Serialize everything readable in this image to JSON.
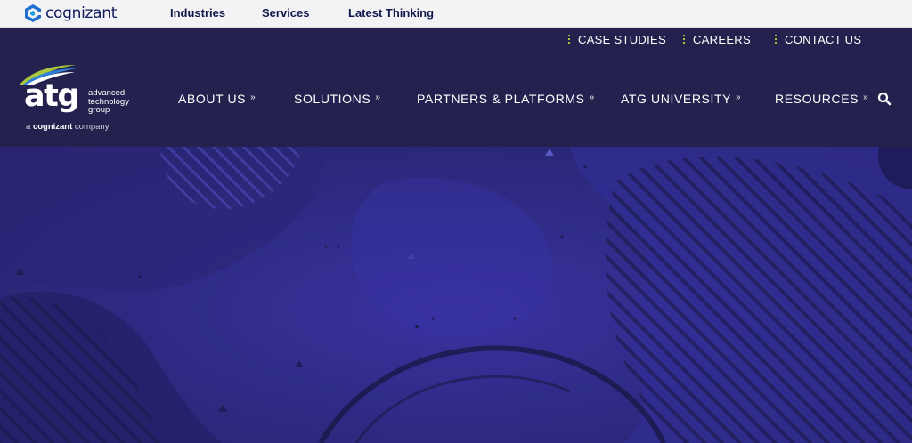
{
  "cognizant_bar": {
    "logo_text": "cognizant",
    "logo_icon": "cognizant-hex-icon",
    "links": [
      "Industries",
      "Services",
      "Latest Thinking"
    ]
  },
  "utility_nav": {
    "items": [
      "CASE STUDIES",
      "CAREERS",
      "CONTACT US"
    ],
    "bullet_color": "#a9c73a"
  },
  "atg_logo": {
    "wordmark": "atg",
    "desc_lines": [
      "advanced",
      "technology",
      "group"
    ],
    "tagline_prefix": "a",
    "tagline_brand": "cognizant",
    "tagline_suffix": "company"
  },
  "main_nav": {
    "items": [
      {
        "label": "ABOUT US",
        "icon": "double-chevron-down-icon"
      },
      {
        "label": "SOLUTIONS",
        "icon": "double-chevron-down-icon"
      },
      {
        "label": "PARTNERS & PLATFORMS",
        "icon": "double-chevron-down-icon"
      },
      {
        "label": "ATG UNIVERSITY",
        "icon": "double-chevron-down-icon"
      },
      {
        "label": "RESOURCES",
        "icon": "double-chevron-down-icon"
      }
    ],
    "search_icon": "search-icon"
  },
  "colors": {
    "cognizant_bar_bg": "#f3f3f5",
    "header_bg": "#24214e",
    "hero_bg": "#2f2b86",
    "accent_green": "#a9c73a",
    "accent_blue": "#2f7fd8"
  }
}
